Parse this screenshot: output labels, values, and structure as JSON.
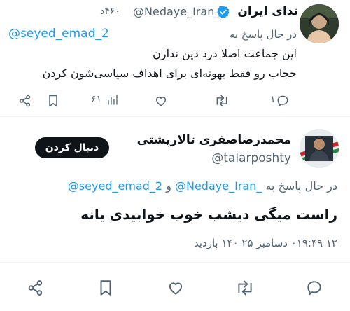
{
  "top_tweet": {
    "display_name": "ندای ایران",
    "handle": "@Nedaye_Iran_",
    "time": "۴۶۰د",
    "replying_to_label": "در حال پاسخ به",
    "replying_to_handle": "@seyed_emad_2",
    "text_line1": "این جماعت اصلا درد دین ندارن",
    "text_line2": "حجاب رو فقط بهونه‌ای برای اهداف سیاسی‌شون کردن",
    "views": "۶۱",
    "replies": "۱",
    "icons": [
      "verified-icon",
      "share-icon",
      "bookmark-icon",
      "views-icon",
      "like-icon",
      "retweet-icon",
      "reply-icon"
    ]
  },
  "main_tweet": {
    "display_name": "محمدرضاصفری تالارپشتی",
    "handle": "@talarposhty",
    "follow_label": "دنبال کردن",
    "replying_to_label": "در حال پاسخ به",
    "replying_to_handle_1": "@Nedaye_Iran_",
    "replying_to_and": "و",
    "replying_to_handle_2": "@seyed_emad_2",
    "text": "راست میگی دیشب خوب خوابیدی یانه",
    "meta": "۱۲ ۰۱۹:۴۹ دسامبر ۲۵ ۱۴۰ بازدید",
    "icons": [
      "share-icon",
      "bookmark-icon",
      "like-icon",
      "retweet-icon",
      "reply-icon"
    ]
  },
  "colors": {
    "link": "#1d9bf0",
    "secondary_text": "#536471",
    "primary_text": "#0f1419",
    "follow_button_bg": "#0f1419",
    "divider": "#eff3f4"
  }
}
